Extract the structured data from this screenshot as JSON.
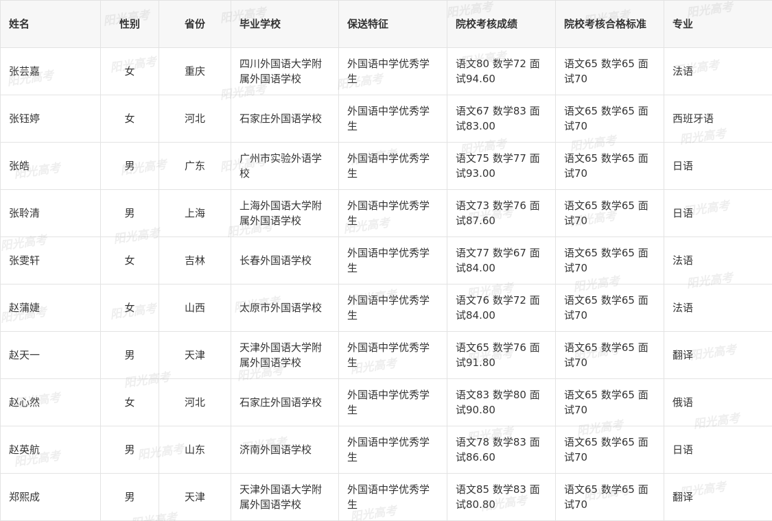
{
  "table": {
    "headers": [
      "姓名",
      "性别",
      "省份",
      "毕业学校",
      "保送特征",
      "院校考核成绩",
      "院校考核合格标准",
      "专业"
    ],
    "rows": [
      [
        "张芸嘉",
        "女",
        "重庆",
        "四川外国语大学附属外国语学校",
        "外国语中学优秀学生",
        "语文80 数学72 面试94.60",
        "语文65 数学65 面试70",
        "法语"
      ],
      [
        "张钰婷",
        "女",
        "河北",
        "石家庄外国语学校",
        "外国语中学优秀学生",
        "语文67 数学83 面试83.00",
        "语文65 数学65 面试70",
        "西班牙语"
      ],
      [
        "张皓",
        "男",
        "广东",
        "广州市实验外语学校",
        "外国语中学优秀学生",
        "语文75 数学77 面试93.00",
        "语文65 数学65 面试70",
        "日语"
      ],
      [
        "张聆清",
        "男",
        "上海",
        "上海外国语大学附属外国语学校",
        "外国语中学优秀学生",
        "语文73 数学76 面试87.60",
        "语文65 数学65 面试70",
        "日语"
      ],
      [
        "张雯轩",
        "女",
        "吉林",
        "长春外国语学校",
        "外国语中学优秀学生",
        "语文77 数学67 面试84.00",
        "语文65 数学65 面试70",
        "法语"
      ],
      [
        "赵蒲婕",
        "女",
        "山西",
        "太原市外国语学校",
        "外国语中学优秀学生",
        "语文76 数学72 面试84.00",
        "语文65 数学65 面试70",
        "法语"
      ],
      [
        "赵天一",
        "男",
        "天津",
        "天津外国语大学附属外国语学校",
        "外国语中学优秀学生",
        "语文65 数学76 面试91.80",
        "语文65 数学65 面试70",
        "翻译"
      ],
      [
        "赵心然",
        "女",
        "河北",
        "石家庄外国语学校",
        "外国语中学优秀学生",
        "语文83 数学80 面试90.80",
        "语文65 数学65 面试70",
        "俄语"
      ],
      [
        "赵英航",
        "男",
        "山东",
        "济南外国语学校",
        "外国语中学优秀学生",
        "语文78 数学83 面试86.60",
        "语文65 数学65 面试70",
        "日语"
      ],
      [
        "郑熙成",
        "男",
        "天津",
        "天津外国语大学附属外国语学校",
        "外国语中学优秀学生",
        "语文85 数学83 面试80.80",
        "语文65 数学65 面试70",
        "翻译"
      ]
    ]
  },
  "watermark": "阳光高考",
  "colors": {
    "header_bg": "#f7f7f7",
    "border": "#e3e3e3",
    "text": "#333333"
  }
}
